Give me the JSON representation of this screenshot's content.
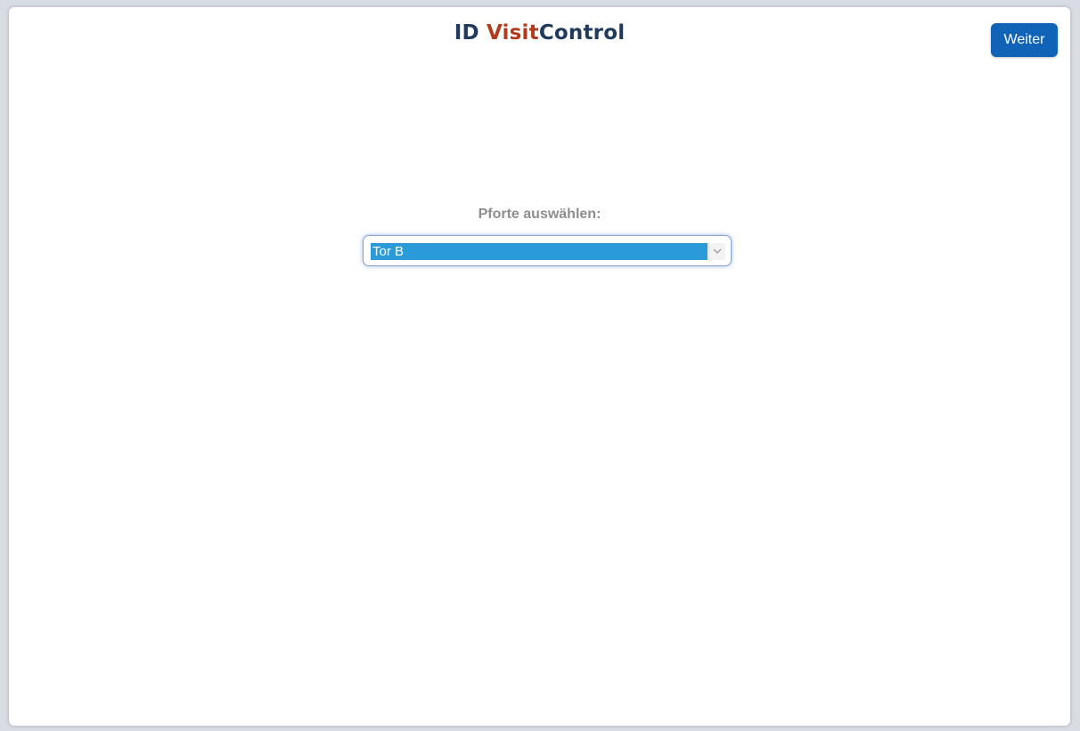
{
  "header": {
    "logo_part1": "ID ",
    "logo_part2": "Visit",
    "logo_part3": "Control",
    "next_button_label": "Weiter"
  },
  "main": {
    "gate_label": "Pforte auswählen:",
    "gate_select": {
      "selected_value": "Tor B"
    }
  },
  "icons": {
    "dropdown": "chevron-down-icon"
  },
  "colors": {
    "brand_dark": "#1f3a5c",
    "brand_red": "#b23a1d",
    "button_blue": "#1163b8",
    "selection_blue": "#2b9ad9",
    "label_gray": "#8e8e8e"
  }
}
